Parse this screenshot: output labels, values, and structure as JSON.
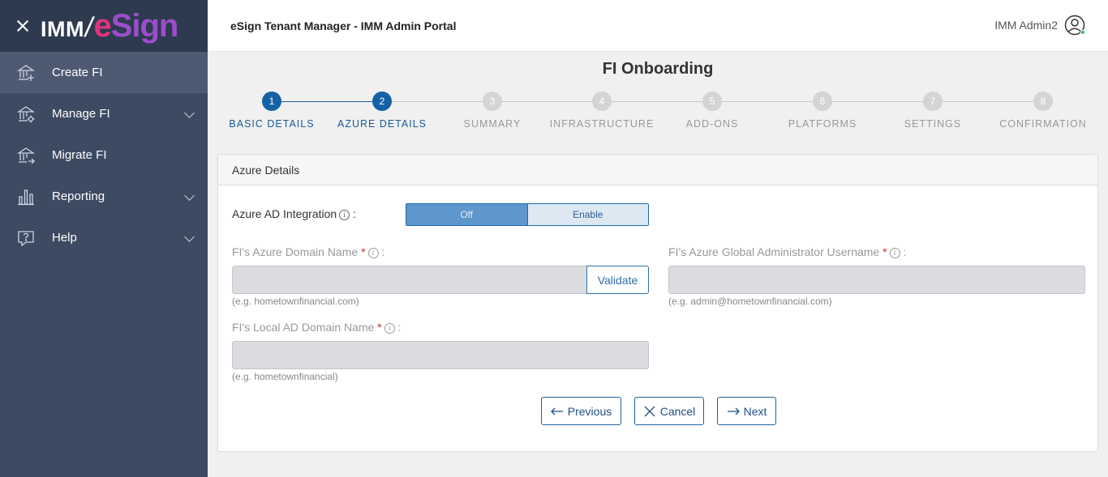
{
  "sidebar": {
    "logo": {
      "imm": "IMM",
      "slash": "/",
      "e": "e",
      "sign": "Sign"
    },
    "items": [
      {
        "label": "Create FI",
        "icon": "bank-add-icon"
      },
      {
        "label": "Manage FI",
        "icon": "bank-settings-icon"
      },
      {
        "label": "Migrate FI",
        "icon": "bank-migrate-icon"
      },
      {
        "label": "Reporting",
        "icon": "bar-chart-icon"
      },
      {
        "label": "Help",
        "icon": "help-icon"
      }
    ]
  },
  "header": {
    "title": "eSign Tenant Manager - IMM Admin Portal",
    "user": "IMM Admin2"
  },
  "page": {
    "title": "FI Onboarding"
  },
  "steps": [
    {
      "num": "1",
      "label": "BASIC DETAILS"
    },
    {
      "num": "2",
      "label": "AZURE DETAILS"
    },
    {
      "num": "3",
      "label": "SUMMARY"
    },
    {
      "num": "4",
      "label": "INFRASTRUCTURE"
    },
    {
      "num": "5",
      "label": "ADD-ONS"
    },
    {
      "num": "6",
      "label": "PLATFORMS"
    },
    {
      "num": "7",
      "label": "SETTINGS"
    },
    {
      "num": "8",
      "label": "CONFIRMATION"
    }
  ],
  "card": {
    "title": "Azure Details",
    "integration": {
      "label": "Azure AD Integration",
      "colon": ":",
      "off": "Off",
      "enable": "Enable",
      "selected": "Off"
    },
    "domain": {
      "label": "FI's Azure Domain Name",
      "req": "*",
      "colon": ":",
      "value": "",
      "hint": "(e.g. hometownfinancial.com)",
      "validate": "Validate"
    },
    "admin": {
      "label": "FI's Azure Global Administrator Username",
      "req": "*",
      "colon": ":",
      "value": "",
      "hint": "(e.g. admin@hometownfinancial.com)"
    },
    "local": {
      "label": "FI's Local AD Domain Name",
      "req": "*",
      "colon": ":",
      "value": "",
      "hint": "(e.g. hometownfinancial)"
    }
  },
  "buttons": {
    "previous": "Previous",
    "cancel": "Cancel",
    "next": "Next"
  },
  "info_glyph": "i",
  "colors": {
    "sidebar": "#3c4a62",
    "accent": "#1461a6",
    "brand_pink": "#e0347f",
    "brand_purple": "#9b4ec9"
  }
}
